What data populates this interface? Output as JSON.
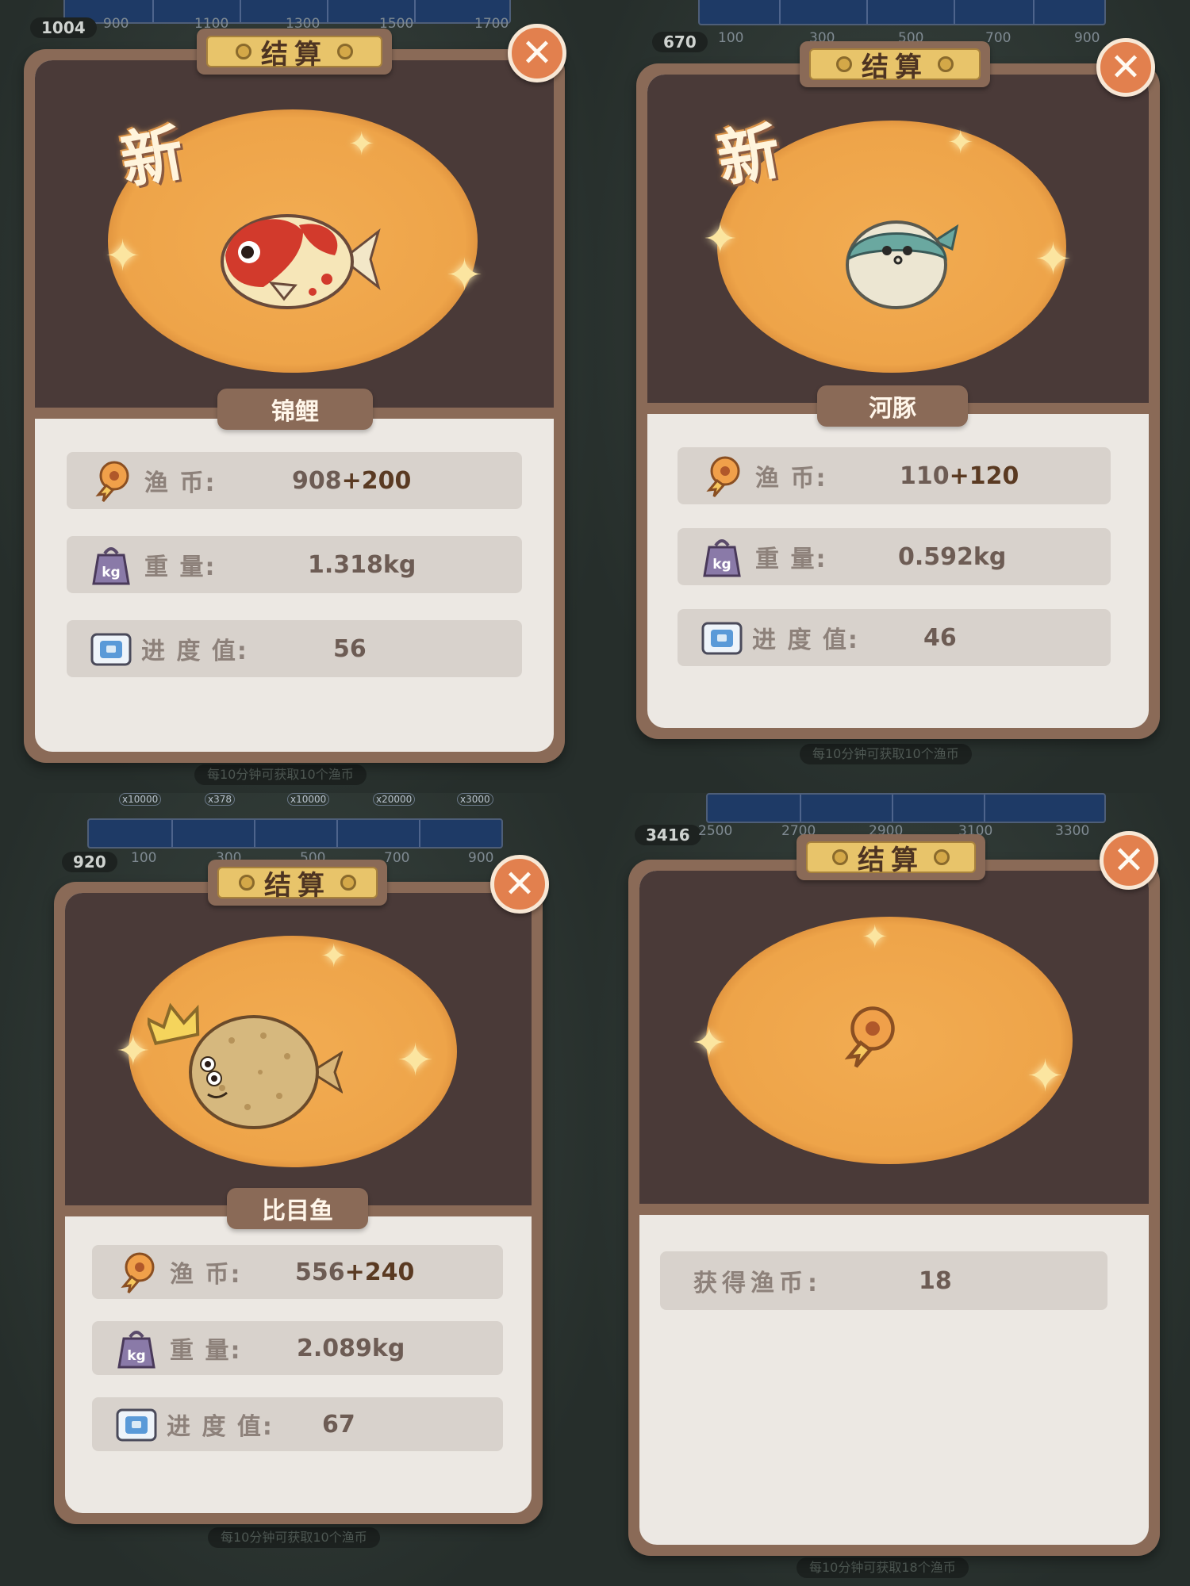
{
  "panels": [
    {
      "title": "结算",
      "is_new": true,
      "new_label": "新",
      "fish_name": "锦鲤",
      "rows": [
        {
          "icon": "fish-coin-icon",
          "label": "渔  币:",
          "value": "908",
          "bonus": "+200"
        },
        {
          "icon": "weight-kg-icon",
          "label": "重  量:",
          "value": "1.318kg"
        },
        {
          "icon": "progress-ticket-icon",
          "label": "进 度 值:",
          "value": "56"
        }
      ],
      "background": {
        "level_badge": "1004",
        "ticks": [
          "900",
          "1100",
          "1300",
          "1500",
          "1700"
        ],
        "hint": "每10分钟可获取10个渔币"
      }
    },
    {
      "title": "结算",
      "is_new": true,
      "new_label": "新",
      "fish_name": "河豚",
      "rows": [
        {
          "icon": "fish-coin-icon",
          "label": "渔  币:",
          "value": "110",
          "bonus": "+120"
        },
        {
          "icon": "weight-kg-icon",
          "label": "重  量:",
          "value": "0.592kg"
        },
        {
          "icon": "progress-ticket-icon",
          "label": "进 度 值:",
          "value": "46"
        }
      ],
      "background": {
        "level_badge": "670",
        "ticks": [
          "100",
          "300",
          "500",
          "700",
          "900"
        ],
        "hint": "每10分钟可获取10个渔币"
      }
    },
    {
      "title": "结算",
      "is_new": false,
      "has_crown": true,
      "fish_name": "比目鱼",
      "rows": [
        {
          "icon": "fish-coin-icon",
          "label": "渔  币:",
          "value": "556",
          "bonus": "+240"
        },
        {
          "icon": "weight-kg-icon",
          "label": "重  量:",
          "value": "2.089kg"
        },
        {
          "icon": "progress-ticket-icon",
          "label": "进 度 值:",
          "value": "67"
        }
      ],
      "background": {
        "level_badge": "920",
        "ticks": [
          "100",
          "300",
          "500",
          "700",
          "900"
        ],
        "multipliers": [
          "x10000",
          "x378",
          "x10000",
          "x20000",
          "x3000"
        ],
        "hint": "每10分钟可获取10个渔币"
      }
    },
    {
      "title": "结算",
      "is_new": false,
      "fish_name": "",
      "rows": [
        {
          "icon": "",
          "label": "获得渔币:",
          "value": "18"
        }
      ],
      "background": {
        "level_badge": "3416",
        "ticks": [
          "2500",
          "2700",
          "2900",
          "3100",
          "3300"
        ],
        "hint": "每10分钟可获取18个渔币"
      }
    }
  ],
  "close_glyph": "✕",
  "colors": {
    "card_frame": "#8a6a57",
    "card_top": "#4a3a38",
    "card_body": "#ece8e3",
    "glow": "#eea449",
    "title_plaque": "#e8c46a",
    "close_button": "#e2804e",
    "row_bg": "#d8d2cc"
  }
}
